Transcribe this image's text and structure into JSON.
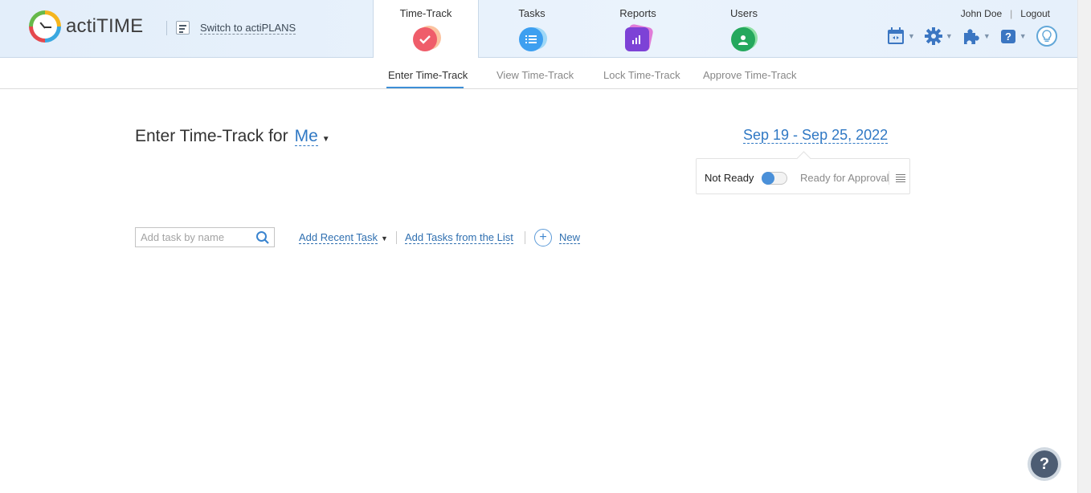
{
  "app": {
    "logo_text": "actiTIME",
    "switch_label": "Switch to actiPLANS"
  },
  "modules": [
    {
      "label": "Time-Track",
      "icon": "checkmark-icon",
      "color": "#f06a73",
      "active": true
    },
    {
      "label": "Tasks",
      "icon": "task-list-icon",
      "color": "#3d9ff0",
      "active": false
    },
    {
      "label": "Reports",
      "icon": "bar-chart-icon",
      "color": "#8d4ce0",
      "active": false
    },
    {
      "label": "Users",
      "icon": "user-icon",
      "color": "#2fb56a",
      "active": false
    }
  ],
  "user": {
    "name": "John Doe",
    "separator": "|",
    "logout": "Logout"
  },
  "toolbar_icons": [
    "calendar-icon",
    "gear-icon",
    "puzzle-icon",
    "help-icon",
    "lightbulb-icon"
  ],
  "subtabs": [
    {
      "label": "Enter Time-Track",
      "active": true
    },
    {
      "label": "View Time-Track",
      "active": false
    },
    {
      "label": "Lock Time-Track",
      "active": false
    },
    {
      "label": "Approve Time-Track",
      "active": false
    }
  ],
  "page": {
    "title_prefix": "Enter Time-Track for",
    "who": "Me",
    "date_range": "Sep 19 - Sep 25, 2022"
  },
  "approval": {
    "not_ready": "Not Ready",
    "ready": "Ready for Approval",
    "state": "Not Ready"
  },
  "add_tasks": {
    "search_placeholder": "Add task by name",
    "recent": "Add Recent Task",
    "from_list": "Add Tasks from the List",
    "new": "New"
  },
  "help": {
    "label": "?"
  },
  "colors": {
    "accent": "#2f78c4",
    "header_bg": "#e6f0fb"
  }
}
